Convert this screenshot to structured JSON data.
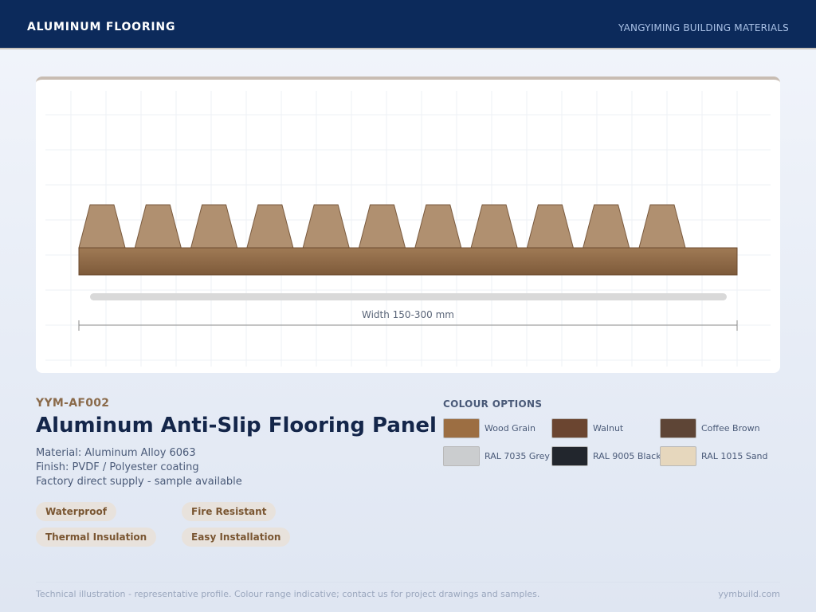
{
  "header": {
    "title": "ALUMINUM FLOORING",
    "company": "YANGYIMING BUILDING MATERIALS"
  },
  "illustration": {
    "rib_count": 11,
    "dimension_label": "Width 150-300 mm",
    "profile_color": "#b09070",
    "base_color_top": "#a07a55",
    "base_color_bottom": "#7d5a3a"
  },
  "product": {
    "sku": "YYM-AF002",
    "name": "Aluminum Anti-Slip Flooring Panel",
    "specs": [
      "Material: Aluminum Alloy 6063",
      "Finish: PVDF / Polyester coating",
      "Factory direct supply - sample available"
    ],
    "tags": [
      "Waterproof",
      "Fire Resistant",
      "Thermal Insulation",
      "Easy Installation"
    ]
  },
  "colours": {
    "heading": "COLOUR OPTIONS",
    "options": [
      {
        "label": "Wood Grain",
        "color": "#9c6e42"
      },
      {
        "label": "Walnut",
        "color": "#6b4530"
      },
      {
        "label": "Coffee Brown",
        "color": "#5e4536"
      },
      {
        "label": "RAL 7035 Grey",
        "color": "#cbcdcf"
      },
      {
        "label": "RAL 9005 Black",
        "color": "#22262d"
      },
      {
        "label": "RAL 1015 Sand",
        "color": "#e6d7bd"
      }
    ]
  },
  "footer": {
    "note": "Technical illustration - representative profile. Colour range indicative; contact us for project drawings and samples.",
    "site": "yymbuild.com"
  }
}
